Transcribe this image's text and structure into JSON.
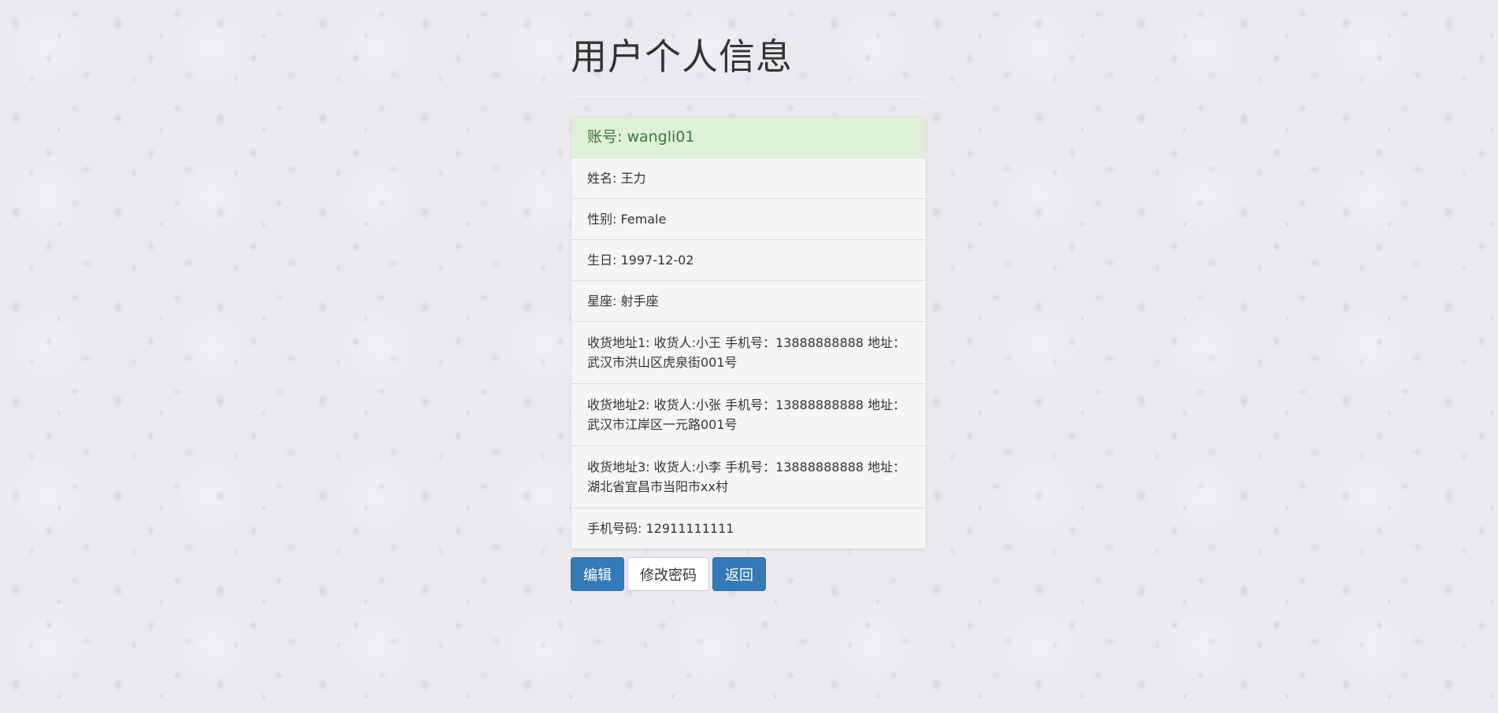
{
  "page": {
    "title": "用户个人信息"
  },
  "info": {
    "account": "账号: wangli01",
    "name": "姓名: 王力",
    "gender": "性别: Female",
    "birthday": "生日: 1997-12-02",
    "zodiac": "星座: 射手座",
    "address1": "收货地址1: 收货人:小王 手机号：13888888888 地址：武汉市洪山区虎泉街001号",
    "address2": "收货地址2: 收货人:小张 手机号：13888888888 地址：武汉市江岸区一元路001号",
    "address3": "收货地址3: 收货人:小李 手机号：13888888888 地址：湖北省宜昌市当阳市xx村",
    "phone": "手机号码: 12911111111"
  },
  "actions": {
    "edit_label": "编辑",
    "change_password_label": "修改密码",
    "back_label": "返回"
  },
  "colors": {
    "primary": "#337ab7",
    "success_bg": "#dff0d8",
    "success_text": "#3c763d",
    "list_bg": "#f5f5f5"
  }
}
